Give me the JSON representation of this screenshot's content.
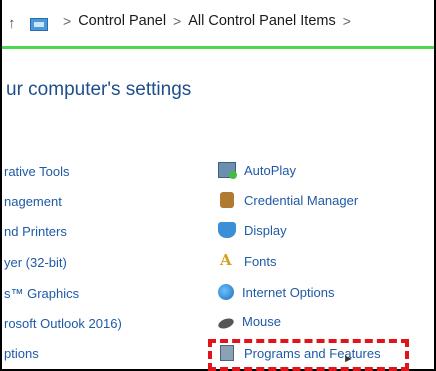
{
  "address_bar": {
    "breadcrumbs": [
      "Control Panel",
      "All Control Panel Items"
    ],
    "separator": ">"
  },
  "heading": "ur computer's settings",
  "left_items": [
    "rative Tools",
    "nagement",
    "nd Printers",
    "yer (32-bit)",
    "s™ Graphics",
    "rosoft Outlook 2016)",
    "ptions"
  ],
  "right_items": [
    {
      "label": "AutoPlay",
      "icon": "autoplay-icon"
    },
    {
      "label": "Credential Manager",
      "icon": "credential-manager-icon"
    },
    {
      "label": "Display",
      "icon": "display-icon"
    },
    {
      "label": "Fonts",
      "icon": "fonts-icon"
    },
    {
      "label": "Internet Options",
      "icon": "internet-options-icon"
    },
    {
      "label": "Mouse",
      "icon": "mouse-icon"
    },
    {
      "label": "Programs and Features",
      "icon": "programs-features-icon"
    }
  ],
  "colors": {
    "link": "#1f5aa6",
    "heading": "#1f4e8c",
    "progress": "#4cd84c",
    "highlight": "#e0141a"
  }
}
